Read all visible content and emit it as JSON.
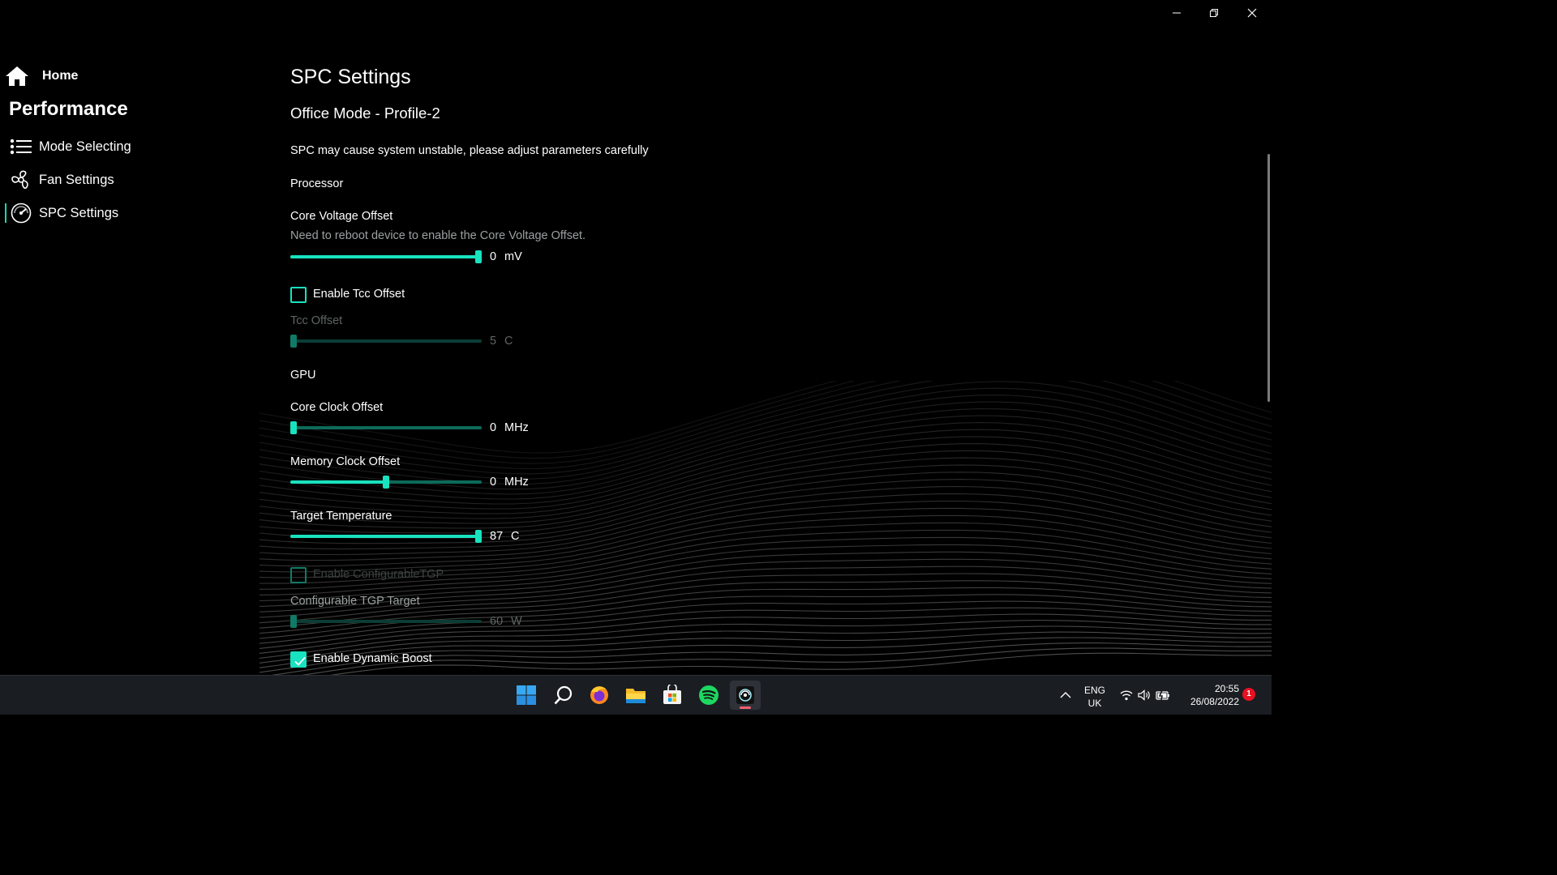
{
  "sidebar": {
    "home_label": "Home",
    "section_title": "Performance",
    "items": [
      {
        "label": "Mode Selecting",
        "icon": "list-icon"
      },
      {
        "label": "Fan Settings",
        "icon": "fan-icon"
      },
      {
        "label": "SPC Settings",
        "icon": "gauge-icon",
        "active": true
      }
    ]
  },
  "content": {
    "title": "SPC Settings",
    "profile": "Office Mode - Profile-2",
    "warning": "SPC may cause system unstable, please adjust parameters carefully",
    "processor_header": "Processor",
    "core_voltage": {
      "label": "Core Voltage Offset",
      "note": "Need to reboot device to enable the Core Voltage Offset.",
      "value": "0",
      "unit": "mV",
      "level": 1.0
    },
    "tcc_checkbox": {
      "label": "Enable Tcc Offset",
      "checked": false
    },
    "tcc_offset": {
      "label": "Tcc Offset",
      "value": "5",
      "unit": "C",
      "level": 0.0,
      "disabled": true
    },
    "gpu_header": "GPU",
    "core_clock": {
      "label": "Core Clock Offset",
      "value": "0",
      "unit": "MHz",
      "level": 0.0
    },
    "memory_clock": {
      "label": "Memory Clock Offset",
      "value": "0",
      "unit": "MHz",
      "level": 0.5
    },
    "target_temp": {
      "label": "Target Temperature",
      "value": "87",
      "unit": "C",
      "level": 1.0
    },
    "tgp_checkbox": {
      "label": "Enable ConfigurableTGP",
      "checked": false,
      "disabled": true
    },
    "tgp_target": {
      "label": "Configurable TGP Target",
      "value": "60",
      "unit": "W",
      "level": 0.0,
      "disabled": true
    },
    "dynamic_boost": {
      "label": "Enable Dynamic Boost",
      "checked": true
    }
  },
  "taskbar": {
    "apps": [
      "windows-start-icon",
      "search-icon",
      "firefox-icon",
      "file-explorer-icon",
      "microsoft-store-icon",
      "spotify-icon",
      "msi-center-icon"
    ],
    "lang_top": "ENG",
    "lang_bottom": "UK",
    "time": "20:55",
    "date": "26/08/2022",
    "notification_count": "1"
  },
  "colors": {
    "accent": "#18e2bf",
    "rail": "#0d6a59",
    "background": "#000000",
    "taskbar": "#1a1d22"
  }
}
